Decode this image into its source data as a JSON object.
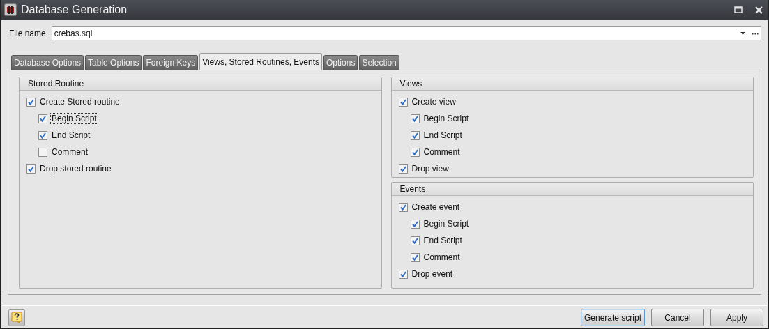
{
  "window": {
    "title": "Database Generation"
  },
  "file_name": {
    "label": "File name",
    "value": "crebas.sql"
  },
  "tabs": [
    {
      "label": "Database Options",
      "selected": false
    },
    {
      "label": "Table Options",
      "selected": false
    },
    {
      "label": "Foreign Keys",
      "selected": false
    },
    {
      "label": "Views, Stored Routines, Events",
      "selected": true
    },
    {
      "label": "Options",
      "selected": false
    },
    {
      "label": "Selection",
      "selected": false
    }
  ],
  "columns": [
    {
      "groups": [
        {
          "title": "Stored Routine",
          "items": [
            {
              "label": "Create Stored routine",
              "checked": true,
              "focused": false,
              "children": [
                {
                  "label": "Begin Script",
                  "checked": true,
                  "focused": true
                },
                {
                  "label": "End Script",
                  "checked": true,
                  "focused": false
                },
                {
                  "label": "Comment",
                  "checked": false,
                  "focused": false
                }
              ]
            },
            {
              "label": "Drop stored routine",
              "checked": true,
              "focused": false
            }
          ]
        }
      ]
    },
    {
      "groups": [
        {
          "title": "Views",
          "items": [
            {
              "label": "Create view",
              "checked": true,
              "focused": false,
              "children": [
                {
                  "label": "Begin Script",
                  "checked": true,
                  "focused": false
                },
                {
                  "label": "End Script",
                  "checked": true,
                  "focused": false
                },
                {
                  "label": "Comment",
                  "checked": true,
                  "focused": false
                }
              ]
            },
            {
              "label": "Drop view",
              "checked": true,
              "focused": false
            }
          ]
        },
        {
          "title": "Events",
          "items": [
            {
              "label": "Create event",
              "checked": true,
              "focused": false,
              "children": [
                {
                  "label": "Begin Script",
                  "checked": true,
                  "focused": false
                },
                {
                  "label": "End Script",
                  "checked": true,
                  "focused": false
                },
                {
                  "label": "Comment",
                  "checked": true,
                  "focused": false
                }
              ]
            },
            {
              "label": "Drop event",
              "checked": true,
              "focused": false
            }
          ]
        }
      ]
    }
  ],
  "buttons": [
    {
      "label": "Generate script",
      "default": true
    },
    {
      "label": "Cancel",
      "default": false
    },
    {
      "label": "Apply",
      "default": false
    }
  ]
}
